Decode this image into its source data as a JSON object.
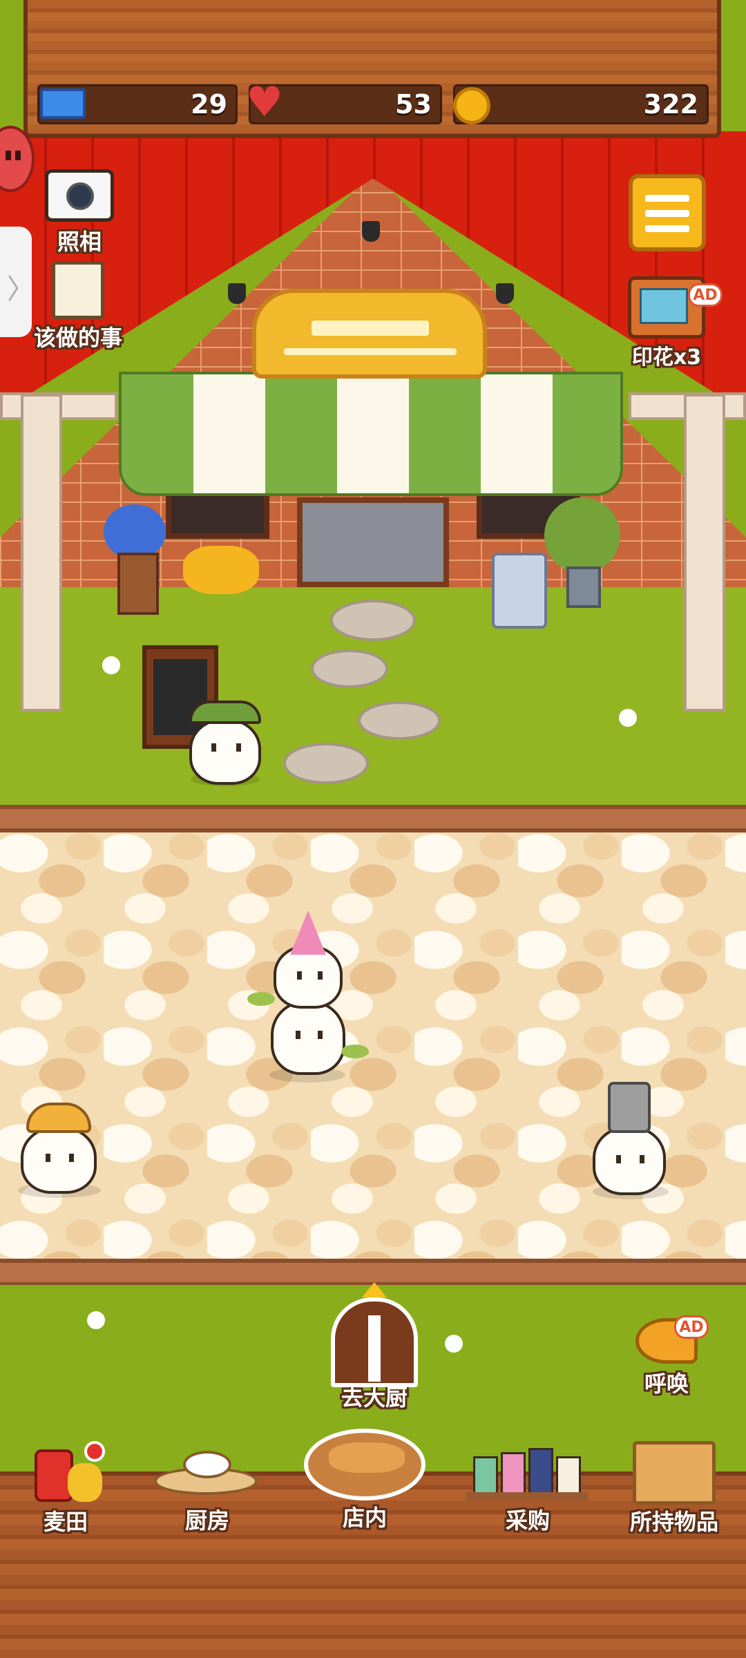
{
  "stats": {
    "tickets": "29",
    "hearts": "53",
    "coins": "322"
  },
  "left_tools": {
    "photo_label": "照相",
    "todo_label": "该做的事"
  },
  "right_tools": {
    "stamp_label": "印花x3",
    "ad_badge": "AD"
  },
  "actions": {
    "kitchen_door_label": "去大厨",
    "call_label": "呼唤",
    "call_ad_badge": "AD"
  },
  "bottom_nav": {
    "items": [
      {
        "label": "麦田"
      },
      {
        "label": "厨房"
      },
      {
        "label": "店内"
      },
      {
        "label": "采购"
      },
      {
        "label": "所持物品"
      }
    ]
  },
  "colors": {
    "roof": "#d8200f",
    "grass": "#93b521",
    "menu_button": "#f7b81b",
    "wood": "#a9582a"
  },
  "icons": [
    "ticket-icon",
    "heart-icon",
    "coin-icon",
    "camera-icon",
    "clipboard-icon",
    "menu-icon",
    "tv-icon",
    "horn-icon",
    "door-icon",
    "wheat-icon",
    "kitchen-icon",
    "bread-basket-icon",
    "shop-stalls-icon",
    "box-icon"
  ]
}
